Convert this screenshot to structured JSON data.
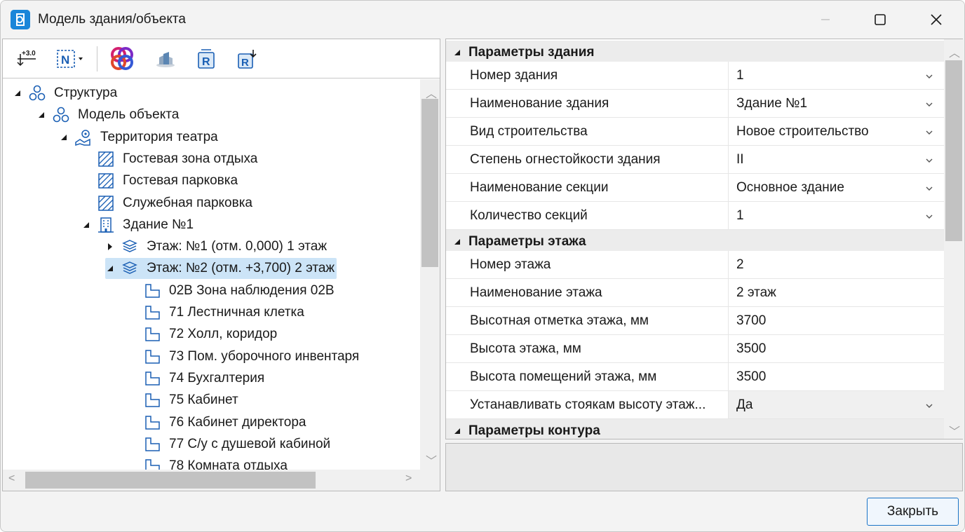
{
  "window": {
    "title": "Модель здания/объекта"
  },
  "toolbar": {
    "buttons": [
      {
        "name": "elevation-tool",
        "glyph": "+3.0"
      },
      {
        "name": "numbering-tool",
        "glyph": "N"
      },
      {
        "name": "nanocad-logo",
        "glyph": ""
      },
      {
        "name": "model-tool",
        "glyph": ""
      },
      {
        "name": "revit-import",
        "glyph": "R"
      },
      {
        "name": "revit-export",
        "glyph": "R"
      }
    ]
  },
  "tree": {
    "nodes": [
      {
        "label": "Структура",
        "level": 0,
        "expanded": true,
        "icon": "structure-icon"
      },
      {
        "label": "Модель объекта",
        "level": 1,
        "expanded": true,
        "icon": "structure-icon"
      },
      {
        "label": "Территория театра",
        "level": 2,
        "expanded": true,
        "icon": "territory-icon"
      },
      {
        "label": "Гостевая зона отдыха",
        "level": 3,
        "icon": "zone-icon"
      },
      {
        "label": "Гостевая парковка",
        "level": 3,
        "icon": "zone-icon"
      },
      {
        "label": "Служебная парковка",
        "level": 3,
        "icon": "zone-icon"
      },
      {
        "label": "Здание №1",
        "level": 3,
        "expanded": true,
        "icon": "building-icon"
      },
      {
        "label": "Этаж: №1 (отм. 0,000) 1 этаж",
        "level": 4,
        "expanded": false,
        "icon": "floor-icon"
      },
      {
        "label": "Этаж: №2 (отм. +3,700) 2 этаж",
        "level": 4,
        "expanded": true,
        "icon": "floor-icon",
        "selected": true
      },
      {
        "label": "02В Зона наблюдения 02В",
        "level": 5,
        "icon": "room-icon"
      },
      {
        "label": "71 Лестничная клетка",
        "level": 5,
        "icon": "room-icon"
      },
      {
        "label": "72 Холл, коридор",
        "level": 5,
        "icon": "room-icon"
      },
      {
        "label": "73 Пом. уборочного инвентаря",
        "level": 5,
        "icon": "room-icon"
      },
      {
        "label": "74 Бухгалтерия",
        "level": 5,
        "icon": "room-icon"
      },
      {
        "label": "75 Кабинет",
        "level": 5,
        "icon": "room-icon"
      },
      {
        "label": "76 Кабинет директора",
        "level": 5,
        "icon": "room-icon"
      },
      {
        "label": "77 С/у с душевой кабиной",
        "level": 5,
        "icon": "room-icon"
      },
      {
        "label": "78 Комната отдыха",
        "level": 5,
        "icon": "room-icon"
      }
    ]
  },
  "properties": {
    "groups": [
      {
        "title": "Параметры здания",
        "rows": [
          {
            "name": "Номер здания",
            "value": "1",
            "dropdown": true
          },
          {
            "name": "Наименование здания",
            "value": "Здание №1",
            "dropdown": true
          },
          {
            "name": "Вид строительства",
            "value": "Новое строительство",
            "dropdown": true
          },
          {
            "name": "Степень огнестойкости здания",
            "value": "II",
            "dropdown": true
          },
          {
            "name": "Наименование секции",
            "value": "Основное здание",
            "dropdown": true
          },
          {
            "name": "Количество секций",
            "value": "1",
            "dropdown": true
          }
        ]
      },
      {
        "title": "Параметры этажа",
        "rows": [
          {
            "name": "Номер этажа",
            "value": "2",
            "dropdown": false
          },
          {
            "name": "Наименование этажа",
            "value": "2 этаж",
            "dropdown": false
          },
          {
            "name": "Высотная отметка этажа, мм",
            "value": "3700",
            "dropdown": false
          },
          {
            "name": "Высота этажа, мм",
            "value": "3500",
            "dropdown": false
          },
          {
            "name": "Высота помещений этажа, мм",
            "value": "3500",
            "dropdown": false
          },
          {
            "name": "Устанавливать стоякам высоту этаж...",
            "value": "Да",
            "dropdown": true,
            "active": true
          }
        ]
      },
      {
        "title": "Параметры контура",
        "rows": []
      }
    ]
  },
  "footer": {
    "close_label": "Закрыть"
  },
  "colors": {
    "accent": "#1a74c6",
    "selection": "#cce4f7",
    "icon_blue": "#1a5fb4"
  }
}
